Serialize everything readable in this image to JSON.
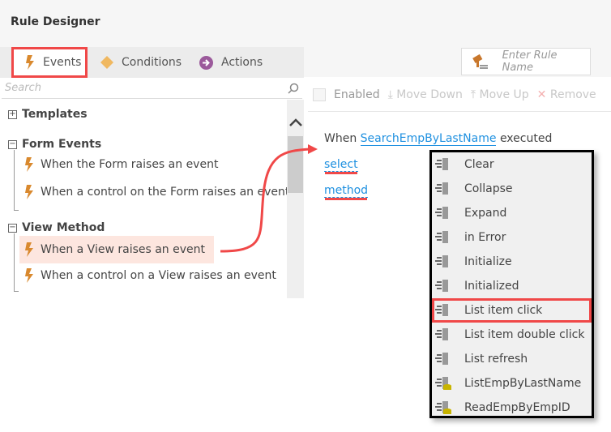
{
  "title": "Rule Designer",
  "tabs": [
    {
      "label": "Events"
    },
    {
      "label": "Conditions"
    },
    {
      "label": "Actions"
    }
  ],
  "rule_name_placeholder": "Enter Rule Name",
  "search_placeholder": "Search",
  "tree": {
    "templates": "Templates",
    "form_events": {
      "label": "Form Events",
      "items": [
        "When the Form raises an event",
        "When a control on the Form raises an event"
      ]
    },
    "view_method": {
      "label": "View Method",
      "items": [
        "When a View raises an event",
        "When a control on a View raises an event"
      ]
    }
  },
  "toolbar": {
    "enabled": "Enabled",
    "move_down": "Move Down",
    "move_up": "Move Up",
    "remove": "Remove"
  },
  "rule": {
    "when": "When",
    "view": "SearchEmpByLastName",
    "executed": "executed",
    "select": "select",
    "method": "method"
  },
  "methods": [
    "Clear",
    "Collapse",
    "Expand",
    "in Error",
    "Initialize",
    "Initialized",
    "List item click",
    "List item double click",
    "List refresh",
    "ListEmpByLastName",
    "ReadEmpByEmpID"
  ],
  "colors": {
    "highlight": "#f04848",
    "link": "#1e90e0",
    "event": "#d9892e"
  }
}
